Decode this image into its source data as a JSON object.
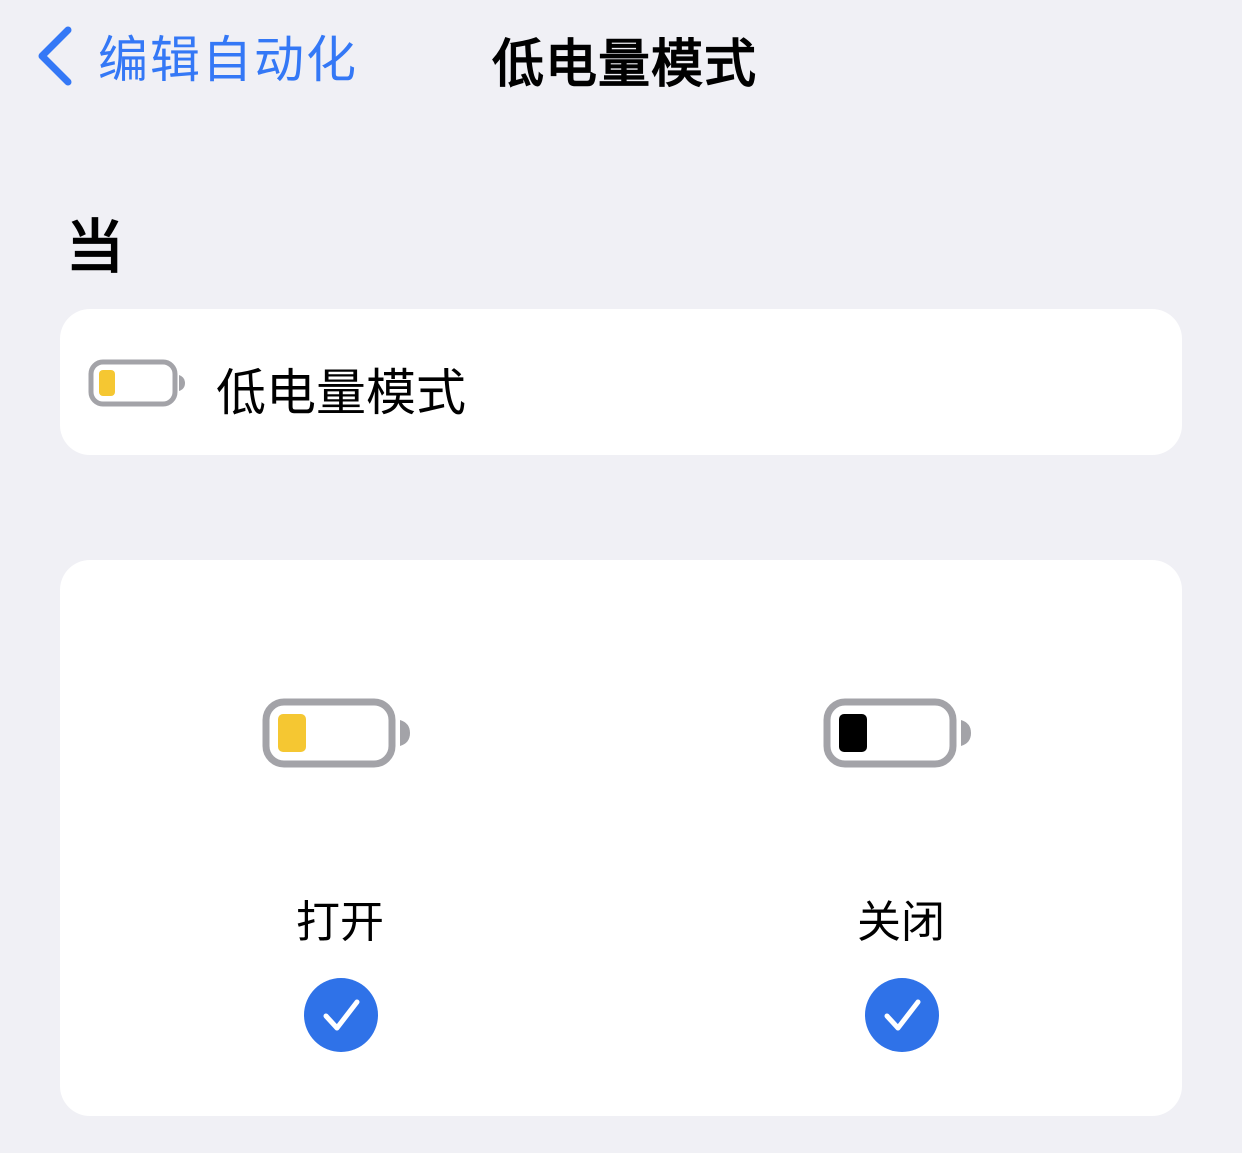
{
  "nav": {
    "back_label": "编辑自动化",
    "title": "低电量模式",
    "accent": "#3478f6"
  },
  "section": {
    "header": "当"
  },
  "trigger": {
    "label": "低电量模式",
    "icon": "battery-low-icon"
  },
  "options": [
    {
      "label": "打开",
      "icon": "battery-low-yellow-icon",
      "selected": true,
      "fill_color": "#f5c732"
    },
    {
      "label": "关闭",
      "icon": "battery-low-black-icon",
      "selected": true,
      "fill_color": "#000000"
    }
  ],
  "colors": {
    "background": "#f0f0f5",
    "card": "#ffffff",
    "check": "#2f72e8",
    "battery_outline": "#a3a3a8"
  }
}
